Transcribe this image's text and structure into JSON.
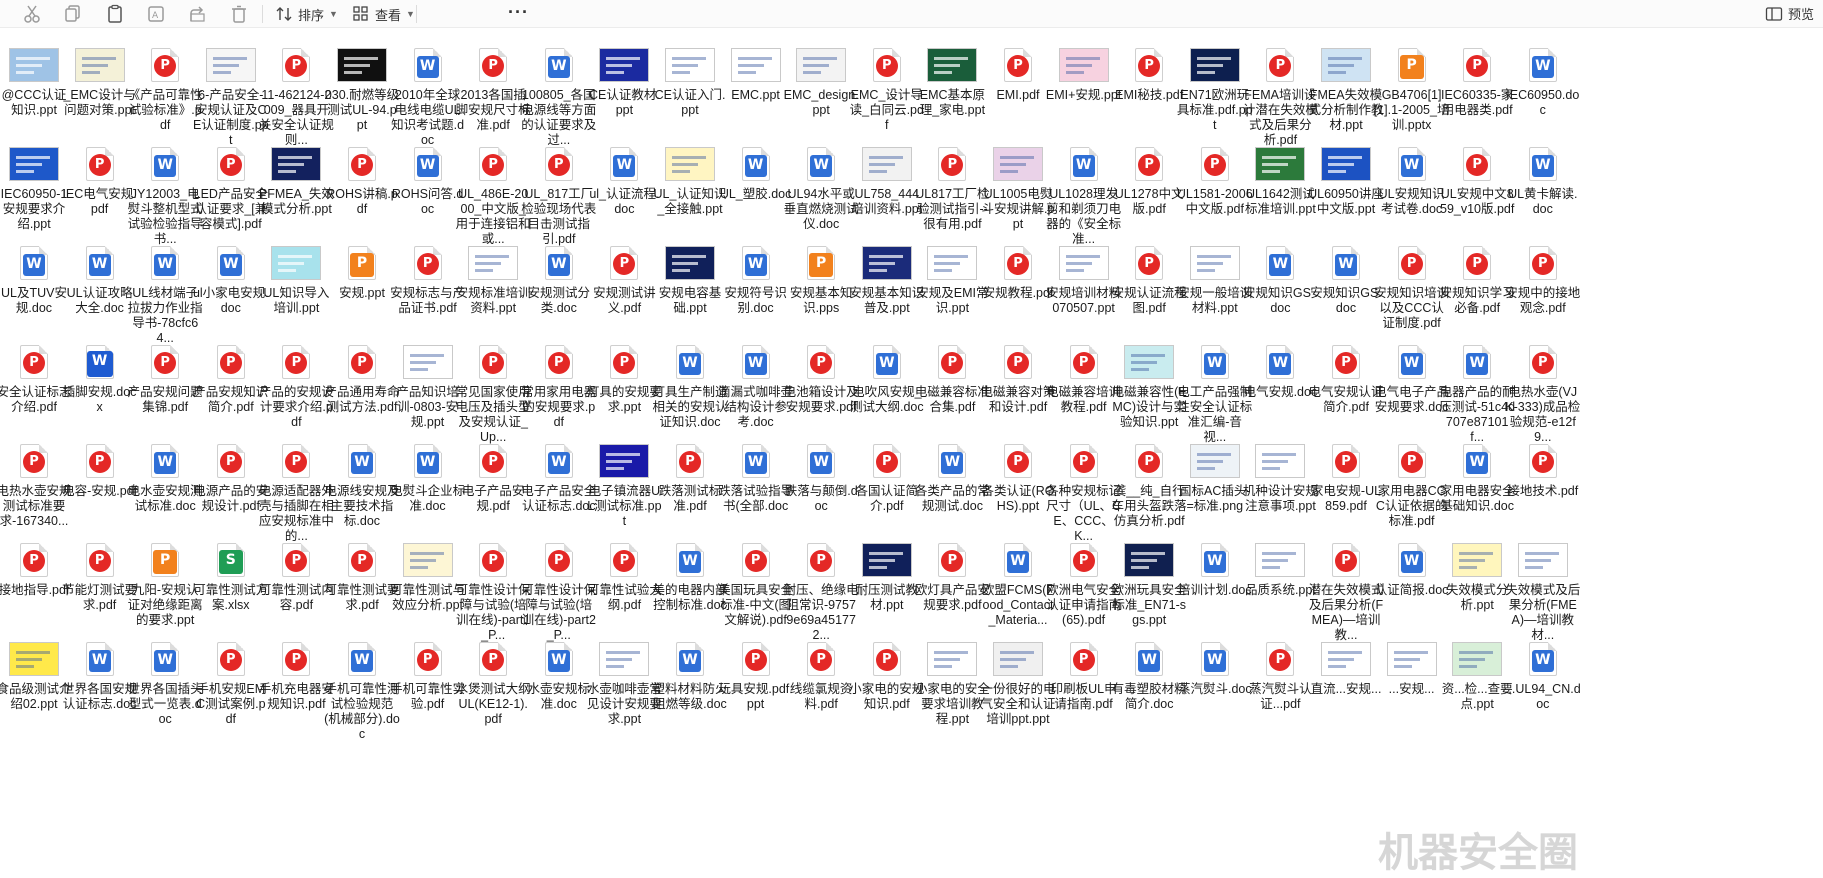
{
  "toolbar": {
    "sort_label": "排序",
    "view_label": "查看",
    "more_label": "···",
    "preview_label": "预览"
  },
  "colors": {
    "pdf": "#e42826",
    "doc": "#2f6fd6",
    "ppt_wps": "#f2811d",
    "xls": "#1f9d55"
  },
  "watermark": "机器安全圈",
  "files": [
    {
      "name": "@CCC认证知识.ppt",
      "icon": "thumb",
      "thumb": "#9fc3e6"
    },
    {
      "name": "_EMC设计与问题对策.ppt",
      "icon": "thumb",
      "thumb": "#f4f1d8"
    },
    {
      "name": "《产品可靠性试验标准》.pdf",
      "icon": "pdf"
    },
    {
      "name": "6-产品安全-安规认证及CE认证制度.ppt",
      "icon": "thumb",
      "thumb": "#f6f6f6"
    },
    {
      "name": "11-462124-2009_器具开关安全认证规则...",
      "icon": "pdf"
    },
    {
      "name": "030.耐燃等级测试UL-94.ppt",
      "icon": "thumb",
      "thumb": "#101010"
    },
    {
      "name": "2010年全球电线电缆UL知识考试题.doc",
      "icon": "doc"
    },
    {
      "name": "2013各国插脚安规尺寸标准.pdf",
      "icon": "pdf"
    },
    {
      "name": "100805_各国电源线等方面的认证要求及过...",
      "icon": "doc"
    },
    {
      "name": "CE认证教材.ppt",
      "icon": "thumb",
      "thumb": "#1b2aa0"
    },
    {
      "name": "CE认证入门.ppt",
      "icon": "thumb",
      "thumb": "#ffffff"
    },
    {
      "name": "EMC.ppt",
      "icon": "thumb",
      "thumb": "#ffffff"
    },
    {
      "name": "EMC_design.ppt",
      "icon": "thumb",
      "thumb": "#f3f3f3"
    },
    {
      "name": "EMC_设计导读_白同云.pdf",
      "icon": "pdf"
    },
    {
      "name": "EMC基本原理_家电.ppt",
      "icon": "thumb",
      "thumb": "#1a5d3a"
    },
    {
      "name": "EMI.pdf",
      "icon": "pdf"
    },
    {
      "name": "EMI+安规.ppt",
      "icon": "thumb",
      "thumb": "#f7d2e0"
    },
    {
      "name": "EMI秘技.pdf",
      "icon": "pdf"
    },
    {
      "name": "EN71欧洲玩具标准.pdf.ppt",
      "icon": "thumb",
      "thumb": "#0d1f4f"
    },
    {
      "name": "FEMA培训设计潜在失效模式及后果分析.pdf",
      "icon": "pdf"
    },
    {
      "name": "FMEA失效模式分析制作教材.ppt",
      "icon": "thumb",
      "thumb": "#cfe3f3"
    },
    {
      "name": "GB4706[1][1].1-2005_培训.pptx",
      "icon": "pptw"
    },
    {
      "name": "IEC60335-家用电器类.pdf",
      "icon": "pdf"
    },
    {
      "name": "IEC60950.doc",
      "icon": "doc"
    },
    {
      "name": "IEC60950-1安规要求介绍.ppt",
      "icon": "thumb",
      "thumb": "#1e58c9"
    },
    {
      "name": "IEC电气安规.pdf",
      "icon": "pdf"
    },
    {
      "name": "JY12003_电熨斗整机型式试验检验指导书...",
      "icon": "doc"
    },
    {
      "name": "LED产品安全认证要求_[兼容模式].pdf",
      "icon": "pdf"
    },
    {
      "name": "PFMEA_失效模式分析.ppt",
      "icon": "thumb",
      "thumb": "#13215e"
    },
    {
      "name": "ROHS讲稿.pdf",
      "icon": "pdf"
    },
    {
      "name": "ROHS问答.doc",
      "icon": "doc"
    },
    {
      "name": "UL_486E-2000_中文版_用于连接铝和或...",
      "icon": "pdf"
    },
    {
      "name": "UL_817工厂检验现场代表目击测试指引.pdf",
      "icon": "pdf"
    },
    {
      "name": "ul_认证流程.doc",
      "icon": "doc"
    },
    {
      "name": "UL_认证知识_全接触.ppt",
      "icon": "thumb",
      "thumb": "#fff5c2"
    },
    {
      "name": "UL_塑胶.doc",
      "icon": "doc"
    },
    {
      "name": "UL94水平或垂直燃烧测试仪.doc",
      "icon": "doc"
    },
    {
      "name": "UL758_444培训资料.ppt",
      "icon": "thumb",
      "thumb": "#f2f2f2"
    },
    {
      "name": "UL817工厂检验测试指引--很有用.pdf",
      "icon": "pdf"
    },
    {
      "name": "UL1005电熨斗安规讲解.ppt",
      "icon": "thumb",
      "thumb": "#ead2e8"
    },
    {
      "name": "UL1028理发剪和剃须刀电器的《安全标准...",
      "icon": "doc"
    },
    {
      "name": "UL1278中文版.pdf",
      "icon": "pdf"
    },
    {
      "name": "UL1581-2006中文版.pdf",
      "icon": "pdf"
    },
    {
      "name": "UL1642测试标准培训.ppt",
      "icon": "thumb",
      "thumb": "#2c7a3b"
    },
    {
      "name": "UL60950讲座中文版.ppt",
      "icon": "thumb",
      "thumb": "#1c52c2"
    },
    {
      "name": "UL安规知识考试卷.doc",
      "icon": "doc"
    },
    {
      "name": "UL安规中文859_v10版.pdf",
      "icon": "pdf"
    },
    {
      "name": "UL黄卡解读.doc",
      "icon": "doc"
    },
    {
      "name": "UL及TUV安规.doc",
      "icon": "doc"
    },
    {
      "name": "UL认证攻略大全.doc",
      "icon": "doc"
    },
    {
      "name": "UL线材端子拉拔力作业指导书-78cfc64...",
      "icon": "doc"
    },
    {
      "name": "ul小家电安规.doc",
      "icon": "doc"
    },
    {
      "name": "UL知识导入培训.ppt",
      "icon": "thumb",
      "thumb": "#a8e2ec"
    },
    {
      "name": "安规.ppt",
      "icon": "pptw"
    },
    {
      "name": "安规标志与产品证书.pdf",
      "icon": "pdf"
    },
    {
      "name": "安规标准培训资料.ppt",
      "icon": "thumb",
      "thumb": "#ffffff"
    },
    {
      "name": "安规测试分类.doc",
      "icon": "doc"
    },
    {
      "name": "安规测试讲义.pdf",
      "icon": "pdf"
    },
    {
      "name": "安规电容基础.ppt",
      "icon": "thumb",
      "thumb": "#10205a"
    },
    {
      "name": "安规符号识别.doc",
      "icon": "doc"
    },
    {
      "name": "安规基本知识.pps",
      "icon": "pptw"
    },
    {
      "name": "安规基本知识普及.ppt",
      "icon": "thumb",
      "thumb": "#1b2b7a"
    },
    {
      "name": "安规及EMI常识.ppt",
      "icon": "thumb",
      "thumb": "#ffffff"
    },
    {
      "name": "安规教程.pdf",
      "icon": "pdf"
    },
    {
      "name": "安规培训材料070507.ppt",
      "icon": "thumb",
      "thumb": "#ffffff"
    },
    {
      "name": "安规认证流程图.pdf",
      "icon": "pdf"
    },
    {
      "name": "安规一般培训材料.ppt",
      "icon": "thumb",
      "thumb": "#ffffff"
    },
    {
      "name": "安规知识GS .doc",
      "icon": "doc"
    },
    {
      "name": "安规知识GS.doc",
      "icon": "doc"
    },
    {
      "name": "安规知识培训以及CCC认证制度.pdf",
      "icon": "pdf"
    },
    {
      "name": "安规知识学习必备.pdf",
      "icon": "pdf"
    },
    {
      "name": "安规中的接地观念.pdf",
      "icon": "pdf"
    },
    {
      "name": "安全认证标志介绍.pdf",
      "icon": "pdf"
    },
    {
      "name": "插脚安规.docx",
      "icon": "docx"
    },
    {
      "name": "产品安规问题集锦.pdf",
      "icon": "pdf"
    },
    {
      "name": "产品安规知识简介.pdf",
      "icon": "pdf"
    },
    {
      "name": "产品的安规设计要求介绍.pdf",
      "icon": "pdf"
    },
    {
      "name": "产品通用寿命测试方法.pdf",
      "icon": "pdf"
    },
    {
      "name": "产品知识培训-0803-安规.ppt",
      "icon": "thumb",
      "thumb": "#ffffff"
    },
    {
      "name": "常见国家使用电压及插头型及安规认证_Up...",
      "icon": "pdf"
    },
    {
      "name": "常用家用电器的安规要求.pdf",
      "icon": "pdf"
    },
    {
      "name": "灯具的安规要求.ppt",
      "icon": "pdf"
    },
    {
      "name": "灯具生产制造相关的安规认证知识.doc",
      "icon": "doc"
    },
    {
      "name": "滴漏式咖啡壶结构设计参考.doc",
      "icon": "doc"
    },
    {
      "name": "电池箱设计及安规要求.pdf",
      "icon": "pdf"
    },
    {
      "name": "电吹风安规_测试大纲.doc",
      "icon": "doc"
    },
    {
      "name": "电磁兼容标准合集.pdf",
      "icon": "pdf"
    },
    {
      "name": "电磁兼容对策和设计.pdf",
      "icon": "pdf"
    },
    {
      "name": "电磁兼容培训教程.pdf",
      "icon": "pdf"
    },
    {
      "name": "电磁兼容性(EMC)设计与实验知识.ppt",
      "icon": "thumb",
      "thumb": "#c9ecef"
    },
    {
      "name": "电工产品强制性安全认证标准汇编-音视...",
      "icon": "doc"
    },
    {
      "name": "电气安规.doc",
      "icon": "doc"
    },
    {
      "name": "电气安规认证简介.pdf",
      "icon": "pdf"
    },
    {
      "name": "电气电子产品安规要求.doc",
      "icon": "doc"
    },
    {
      "name": "电器产品的耐压测试-51c4d707e87101f...",
      "icon": "doc"
    },
    {
      "name": "电热水壶(VJK-333)成品检验规范-e12f9...",
      "icon": "pdf"
    },
    {
      "name": "电热水壶安规测试标准要求-167340...",
      "icon": "pdf"
    },
    {
      "name": "电容-安规.pdf",
      "icon": "pdf"
    },
    {
      "name": "电水壶安规测试标准.doc",
      "icon": "doc"
    },
    {
      "name": "电源产品的安规设计.pdf",
      "icon": "pdf"
    },
    {
      "name": "电源适配器外壳与插脚在相应安规标准中的...",
      "icon": "pdf"
    },
    {
      "name": "电源线安规及主要技术指标.doc",
      "icon": "doc"
    },
    {
      "name": "电熨斗企业标准.doc",
      "icon": "doc"
    },
    {
      "name": "电子产品安规.pdf",
      "icon": "pdf"
    },
    {
      "name": "电子产品安全认证标志.doc",
      "icon": "doc"
    },
    {
      "name": "电子镇流器UL测试标准.ppt",
      "icon": "thumb",
      "thumb": "#1a1aa8"
    },
    {
      "name": "跌落测试标准.pdf",
      "icon": "pdf"
    },
    {
      "name": "跌落试验指导书(全部.doc",
      "icon": "doc"
    },
    {
      "name": "跌落与颠倒.doc",
      "icon": "doc"
    },
    {
      "name": "各国认证简介.pdf",
      "icon": "pdf"
    },
    {
      "name": "各类产品的常规测试.doc",
      "icon": "doc"
    },
    {
      "name": "各类认证(ROHS).ppt",
      "icon": "pdf"
    },
    {
      "name": "各种安规标记尺寸（UL、CE、CCC、K...",
      "icon": "pdf"
    },
    {
      "name": "龚__纯_自行车用头盔跌落仿真分析.pdf",
      "icon": "pdf"
    },
    {
      "name": "国标AC插头-=标准.png",
      "icon": "thumb",
      "thumb": "#eef3f7"
    },
    {
      "name": "机种设计安规注意事项.ppt",
      "icon": "thumb",
      "thumb": "#ffffff"
    },
    {
      "name": "家电安规-UL859.pdf",
      "icon": "pdf"
    },
    {
      "name": "家用电器CCC认证依据的标准.pdf",
      "icon": "pdf"
    },
    {
      "name": "家用电器安全基础知识.doc",
      "icon": "doc"
    },
    {
      "name": "接地技术.pdf",
      "icon": "pdf"
    },
    {
      "name": "接地指导.pdf",
      "icon": "pdf"
    },
    {
      "name": "节能灯测试要求.pdf",
      "icon": "pdf"
    },
    {
      "name": "九阳-安规认证对绝缘距离的要求.ppt",
      "icon": "pptw"
    },
    {
      "name": "可靠性测试方案.xlsx",
      "icon": "xls"
    },
    {
      "name": "可靠性测试内容.pdf",
      "icon": "pdf"
    },
    {
      "name": "可靠性测试要求.pdf",
      "icon": "pdf"
    },
    {
      "name": "可靠性测试与效应分析.ppt",
      "icon": "thumb",
      "thumb": "#fdf6d5"
    },
    {
      "name": "可靠性设计保障与试验(培训在线)-part1_P...",
      "icon": "pdf"
    },
    {
      "name": "可靠性设计保障与试验(培训在线)-part2_P...",
      "icon": "pdf"
    },
    {
      "name": "可靠性试验大纲.pdf",
      "icon": "pdf"
    },
    {
      "name": "美的电器内部控制标准.doc",
      "icon": "doc"
    },
    {
      "name": "美国玩具安全标准-中文(图文解说).pdf",
      "icon": "pdf"
    },
    {
      "name": "耐压、绝缘电阻常识-97579e69a451772...",
      "icon": "pdf"
    },
    {
      "name": "耐压测试教材.ppt",
      "icon": "thumb",
      "thumb": "#10205a"
    },
    {
      "name": "欧灯具产品安规要求.pdf",
      "icon": "pdf"
    },
    {
      "name": "欧盟FCMS(Food_Contact_Materia...",
      "icon": "doc"
    },
    {
      "name": "欧洲电气安全认证申请指南(65).pdf",
      "icon": "pdf"
    },
    {
      "name": "欧洲玩具安全标准_EN71-sgs.ppt",
      "icon": "thumb",
      "thumb": "#102050"
    },
    {
      "name": "培训计划.doc",
      "icon": "doc"
    },
    {
      "name": "品质系统.ppt",
      "icon": "thumb",
      "thumb": "#ffffff"
    },
    {
      "name": "潜在失效模式及后果分析(FMEA)—培训教...",
      "icon": "pdf"
    },
    {
      "name": "认证简报.doc",
      "icon": "doc"
    },
    {
      "name": "失效模式分析.ppt",
      "icon": "thumb",
      "thumb": "#fff6bd"
    },
    {
      "name": "失效模式及后果分析(FMEA)—培训教材...",
      "icon": "thumb",
      "thumb": "#ffffff"
    },
    {
      "name": "食品级测试介绍02.ppt",
      "icon": "thumb",
      "thumb": "#ffe94a"
    },
    {
      "name": "世界各国安规认证标志.doc",
      "icon": "doc"
    },
    {
      "name": "世界各国插头型式一览表.doc",
      "icon": "doc"
    },
    {
      "name": "手机安规EMC测试案例.pdf",
      "icon": "pdf"
    },
    {
      "name": "手机充电器安规知识.pdf",
      "icon": "pdf"
    },
    {
      "name": "手机可靠性测试检验规范(机械部分).doc",
      "icon": "doc"
    },
    {
      "name": "手机可靠性实验.pdf",
      "icon": "pdf"
    },
    {
      "name": "水煲测试大纲UL(KE12-1).pdf",
      "icon": "pdf"
    },
    {
      "name": "水壶安规标准.doc",
      "icon": "doc"
    },
    {
      "name": "水壶咖啡壶常见设计安规要求.ppt",
      "icon": "thumb",
      "thumb": "#ffffff"
    },
    {
      "name": "塑料材料防火阻燃等级.doc",
      "icon": "doc"
    },
    {
      "name": "玩具安规.pdf.ppt",
      "icon": "pdf"
    },
    {
      "name": "线缆氯规资料.pdf",
      "icon": "pdf"
    },
    {
      "name": "小家电的安规知识.pdf",
      "icon": "pdf"
    },
    {
      "name": "小家电的安全要求培训教程.ppt",
      "icon": "thumb",
      "thumb": "#ffffff"
    },
    {
      "name": "一份很好的电气安全和认证培训ppt.ppt",
      "icon": "thumb",
      "thumb": "#f0f0f0"
    },
    {
      "name": "印刷板UL申请指南.pdf",
      "icon": "pdf"
    },
    {
      "name": "有毒塑胶材料简介.doc",
      "icon": "doc"
    },
    {
      "name": "蒸汽熨斗.doc",
      "icon": "doc"
    },
    {
      "name": "蒸汽熨斗认证...pdf",
      "icon": "pdf"
    },
    {
      "name": "直流...安规...",
      "icon": "thumb",
      "thumb": "#ffffff"
    },
    {
      "name": "...安规...",
      "icon": "thumb",
      "thumb": "#ffffff"
    },
    {
      "name": "资...检...查要点.ppt",
      "icon": "thumb",
      "thumb": "#d8efd8"
    },
    {
      "name": "...UL94_CN.doc",
      "icon": "doc"
    }
  ]
}
